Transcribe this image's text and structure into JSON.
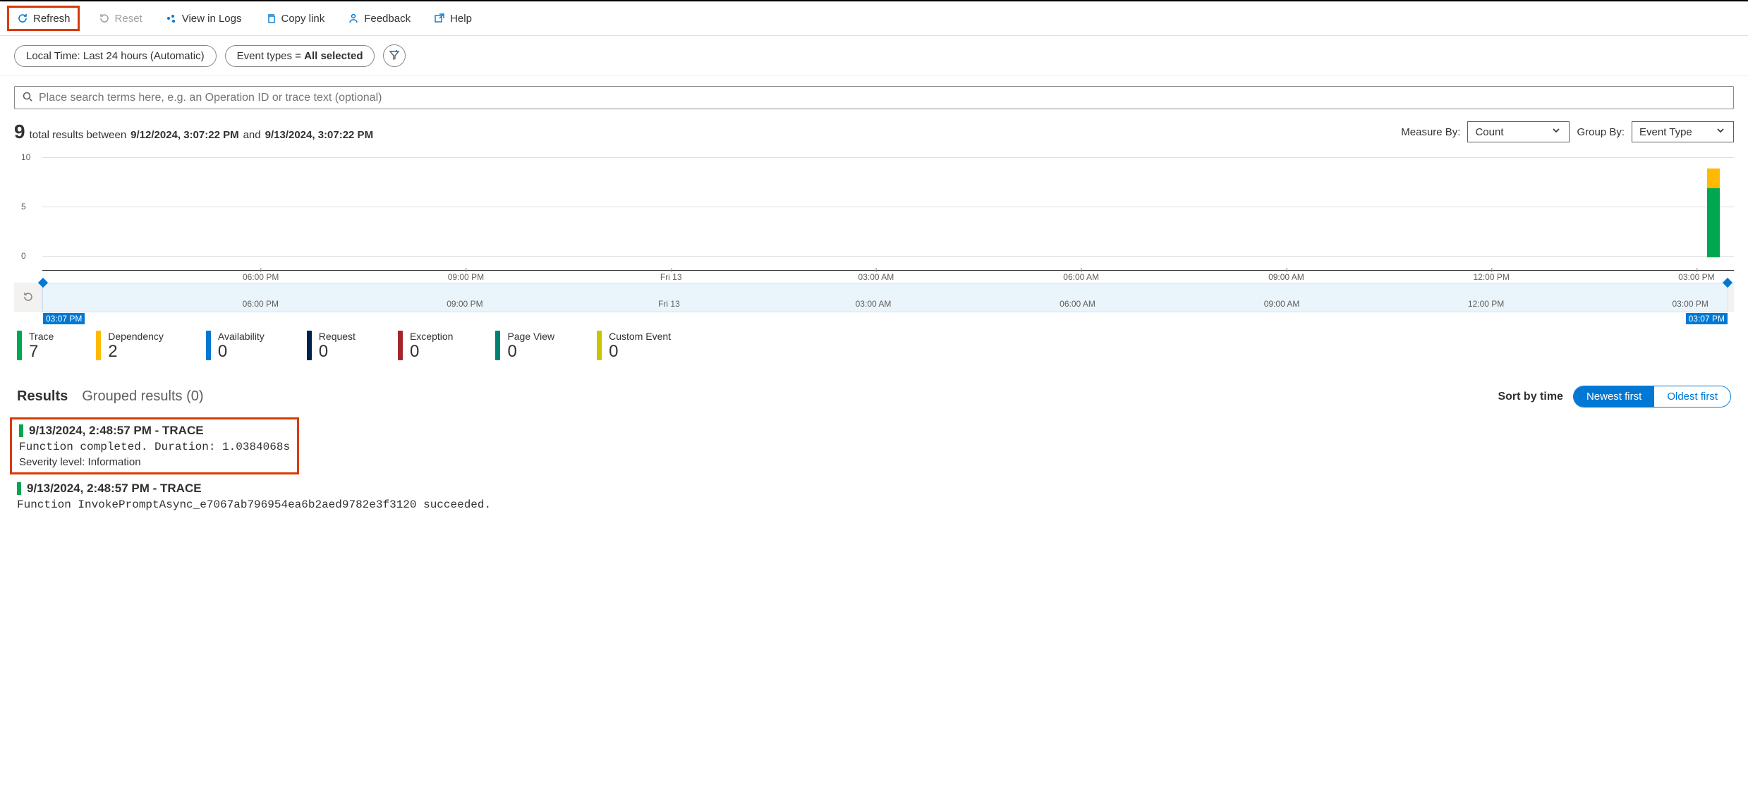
{
  "toolbar": {
    "refresh": "Refresh",
    "reset": "Reset",
    "view_in_logs": "View in Logs",
    "copy_link": "Copy link",
    "feedback": "Feedback",
    "help": "Help"
  },
  "filters": {
    "time": "Local Time: Last 24 hours (Automatic)",
    "event_types_prefix": "Event types = ",
    "event_types_value": "All selected"
  },
  "search": {
    "placeholder": "Place search terms here, e.g. an Operation ID or trace text (optional)"
  },
  "summary": {
    "total": "9",
    "text1": " total results between ",
    "from": "9/12/2024, 3:07:22 PM",
    "text2": " and ",
    "to": "9/13/2024, 3:07:22 PM",
    "measure_by_label": "Measure By:",
    "measure_by_value": "Count",
    "group_by_label": "Group By:",
    "group_by_value": "Event Type"
  },
  "chart_data": {
    "type": "bar",
    "ylabel": "",
    "ylim": [
      0,
      10
    ],
    "yticks": [
      0,
      5,
      10
    ],
    "categories": [
      "06:00 PM",
      "09:00 PM",
      "Fri 13",
      "03:00 AM",
      "06:00 AM",
      "09:00 AM",
      "12:00 PM",
      "03:00 PM"
    ],
    "series": [
      {
        "name": "Trace",
        "color": "#00a650",
        "values": [
          0,
          0,
          0,
          0,
          0,
          0,
          0,
          7
        ]
      },
      {
        "name": "Dependency",
        "color": "#ffb900",
        "values": [
          0,
          0,
          0,
          0,
          0,
          0,
          0,
          2
        ]
      }
    ],
    "brush_ticks": [
      "06:00 PM",
      "09:00 PM",
      "Fri 13",
      "03:00 AM",
      "06:00 AM",
      "09:00 AM",
      "12:00 PM",
      "03:00 PM"
    ],
    "brush_start_label": "03:07 PM",
    "brush_end_label": "03:07 PM"
  },
  "legend": [
    {
      "label": "Trace",
      "count": "7",
      "color": "#00a650"
    },
    {
      "label": "Dependency",
      "count": "2",
      "color": "#ffb900"
    },
    {
      "label": "Availability",
      "count": "0",
      "color": "#0078d4"
    },
    {
      "label": "Request",
      "count": "0",
      "color": "#002050"
    },
    {
      "label": "Exception",
      "count": "0",
      "color": "#a4262c"
    },
    {
      "label": "Page View",
      "count": "0",
      "color": "#008272"
    },
    {
      "label": "Custom Event",
      "count": "0",
      "color": "#c7c400"
    }
  ],
  "tabs": {
    "results": "Results",
    "grouped": "Grouped results (0)"
  },
  "sort": {
    "label": "Sort by time",
    "newest": "Newest first",
    "oldest": "Oldest first"
  },
  "results": [
    {
      "title": "9/13/2024, 2:48:57 PM - TRACE",
      "message": "Function completed. Duration: 1.0384068s",
      "severity": "Severity level: Information",
      "boxed": true
    },
    {
      "title": "9/13/2024, 2:48:57 PM - TRACE",
      "message": "Function InvokePromptAsync_e7067ab796954ea6b2aed9782e3f3120 succeeded.",
      "severity": "",
      "boxed": false
    }
  ]
}
